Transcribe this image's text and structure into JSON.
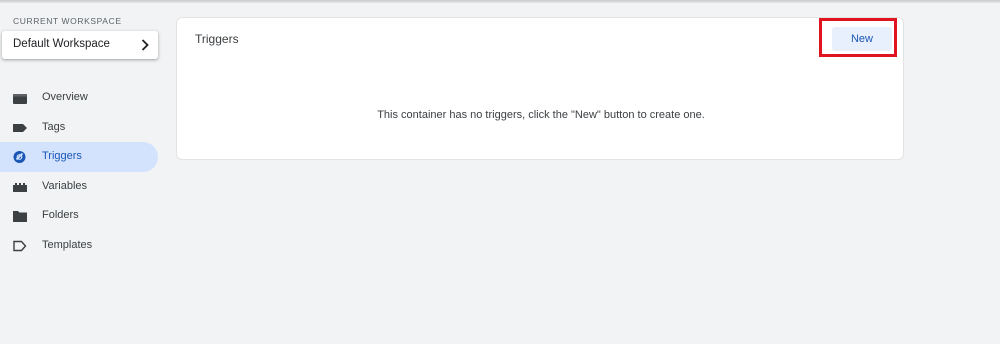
{
  "sidebar": {
    "workspace_caption": "CURRENT WORKSPACE",
    "workspace_name": "Default Workspace",
    "items": [
      {
        "label": "Overview",
        "icon": "overview-icon",
        "active": false
      },
      {
        "label": "Tags",
        "icon": "tag-icon",
        "active": false
      },
      {
        "label": "Triggers",
        "icon": "trigger-icon",
        "active": true
      },
      {
        "label": "Variables",
        "icon": "variables-icon",
        "active": false
      },
      {
        "label": "Folders",
        "icon": "folder-icon",
        "active": false
      },
      {
        "label": "Templates",
        "icon": "templates-icon",
        "active": false
      }
    ]
  },
  "main": {
    "title": "Triggers",
    "new_button_label": "New",
    "empty_message": "This container has no triggers, click the \"New\" button to create one."
  },
  "colors": {
    "accent": "#1a56b6",
    "active_nav_bg": "#d3e3fd",
    "button_bg": "#e8f0fe",
    "highlight_border": "#e0141e",
    "page_bg": "#f1f3f4"
  }
}
